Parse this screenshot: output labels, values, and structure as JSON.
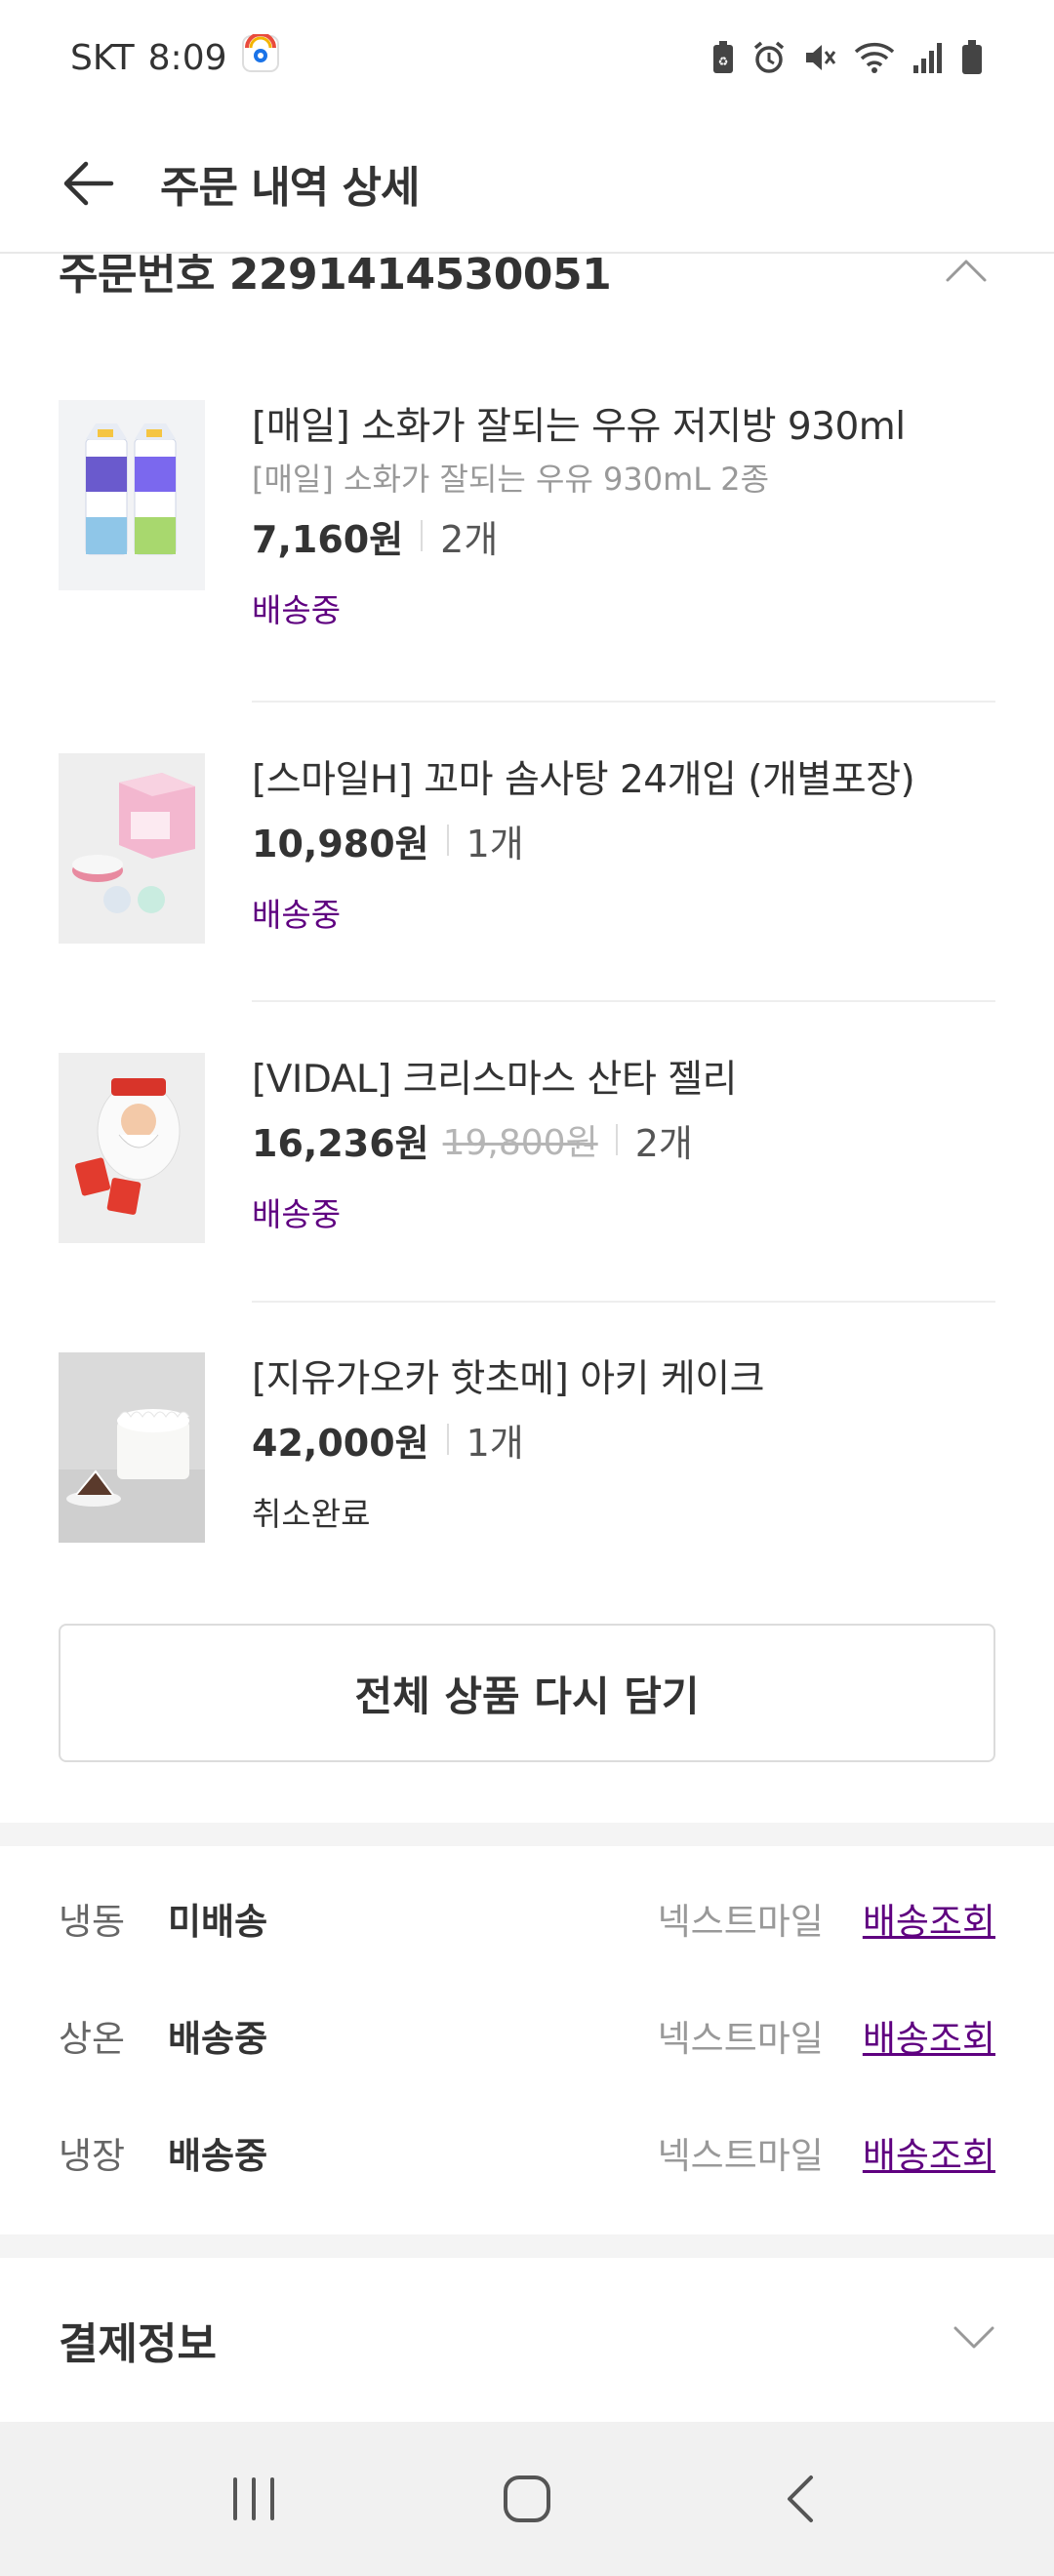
{
  "status_bar": {
    "carrier": "SKT",
    "time": "8:09"
  },
  "header": {
    "title": "주문 내역 상세"
  },
  "order": {
    "number_label": "주문번호 2291414530051"
  },
  "products": [
    {
      "name": "[매일] 소화가 잘되는 우유 저지방 930ml",
      "option": "[매일] 소화가 잘되는 우유 930mL 2종",
      "price": "7,160원",
      "original_price": "",
      "quantity": "2개",
      "status": "배송중"
    },
    {
      "name": "[스마일H] 꼬마 솜사탕 24개입 (개별포장)",
      "option": "",
      "price": "10,980원",
      "original_price": "",
      "quantity": "1개",
      "status": "배송중"
    },
    {
      "name": "[VIDAL] 크리스마스 산타 젤리",
      "option": "",
      "price": "16,236원",
      "original_price": "19,800원",
      "quantity": "2개",
      "status": "배송중"
    },
    {
      "name": "[지유가오카 핫초메] 아키 케이크",
      "option": "",
      "price": "42,000원",
      "original_price": "",
      "quantity": "1개",
      "status": "취소완료"
    }
  ],
  "reorder_button_label": "전체 상품 다시 담기",
  "shipments": [
    {
      "temperature": "냉동",
      "state": "미배송",
      "carrier": "넥스트마일",
      "track_label": "배송조회"
    },
    {
      "temperature": "상온",
      "state": "배송중",
      "carrier": "넥스트마일",
      "track_label": "배송조회"
    },
    {
      "temperature": "냉장",
      "state": "배송중",
      "carrier": "넥스트마일",
      "track_label": "배송조회"
    }
  ],
  "payment": {
    "title": "결제정보"
  },
  "colors": {
    "accent": "#5f0080",
    "text": "#333333",
    "muted": "#999999",
    "divider": "#eeeeee"
  }
}
